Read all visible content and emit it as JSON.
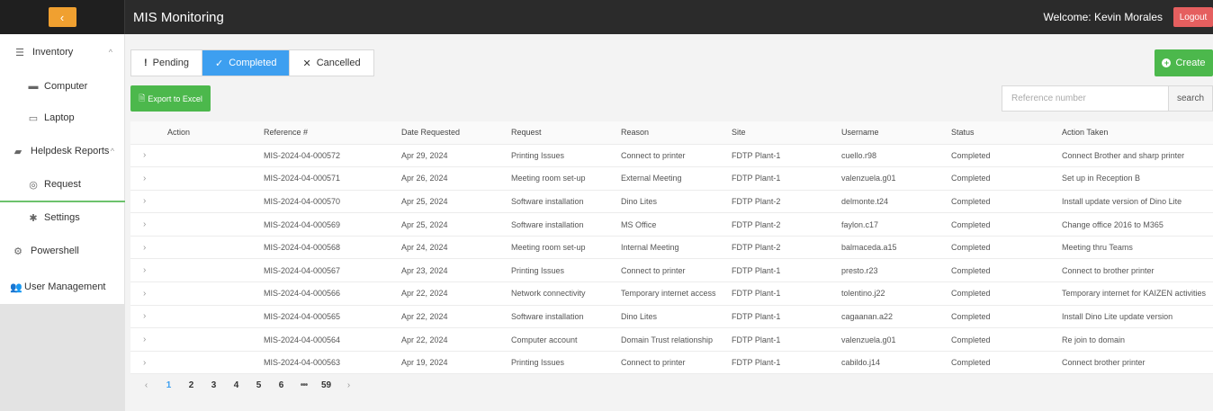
{
  "header": {
    "collapse_icon": "chevron-left-icon",
    "collapse_glyph": "‹",
    "title": "MIS Monitoring",
    "welcome": "Welcome: Kevin Morales",
    "logout_label": "Logout"
  },
  "sidebar": {
    "items": [
      {
        "label": "Inventory",
        "icon": "list-icon",
        "glyph": "☰",
        "chevron": "^"
      },
      {
        "label": "Computer",
        "icon": "desktop-icon",
        "glyph": "▬"
      },
      {
        "label": "Laptop",
        "icon": "laptop-icon",
        "glyph": "▭"
      },
      {
        "label": "Helpdesk Reports",
        "icon": "folder-icon",
        "glyph": "▰",
        "chevron": "^"
      },
      {
        "label": "Request",
        "icon": "headset-icon",
        "glyph": "◎"
      },
      {
        "label": "Settings",
        "icon": "gear-icon",
        "glyph": "✱"
      },
      {
        "label": "Powershell",
        "icon": "cog-icon",
        "glyph": "⚙"
      },
      {
        "label": "User Management",
        "icon": "users-icon",
        "glyph": "👥"
      }
    ]
  },
  "tabs": [
    {
      "label": "Pending",
      "glyph": "!"
    },
    {
      "label": "Completed",
      "glyph": "✓"
    },
    {
      "label": "Cancelled",
      "glyph": "✕"
    }
  ],
  "actions": {
    "create_label": "Create",
    "create_glyph": "+",
    "export_label": "Export to Excel",
    "export_glyph": "🗎"
  },
  "search": {
    "placeholder": "Reference number",
    "button_label": "search"
  },
  "table": {
    "columns": [
      "",
      "Action",
      "Reference #",
      "Date Requested",
      "Request",
      "Reason",
      "Site",
      "Username",
      "Status",
      "Action Taken"
    ],
    "expander_glyph": "›",
    "rows": [
      [
        "MIS-2024-04-000572",
        "Apr 29, 2024",
        "Printing Issues",
        "Connect to printer",
        "FDTP Plant-1",
        "cuello.r98",
        "Completed",
        "Connect Brother and sharp printer"
      ],
      [
        "MIS-2024-04-000571",
        "Apr 26, 2024",
        "Meeting room set-up",
        "External Meeting",
        "FDTP Plant-1",
        "valenzuela.g01",
        "Completed",
        "Set up in Reception B"
      ],
      [
        "MIS-2024-04-000570",
        "Apr 25, 2024",
        "Software installation",
        "Dino Lites",
        "FDTP Plant-2",
        "delmonte.t24",
        "Completed",
        "Install update version of Dino Lite"
      ],
      [
        "MIS-2024-04-000569",
        "Apr 25, 2024",
        "Software installation",
        "MS Office",
        "FDTP Plant-2",
        "faylon.c17",
        "Completed",
        "Change office 2016 to M365"
      ],
      [
        "MIS-2024-04-000568",
        "Apr 24, 2024",
        "Meeting room set-up",
        "Internal Meeting",
        "FDTP Plant-2",
        "balmaceda.a15",
        "Completed",
        "Meeting thru Teams"
      ],
      [
        "MIS-2024-04-000567",
        "Apr 23, 2024",
        "Printing Issues",
        "Connect to printer",
        "FDTP Plant-1",
        "presto.r23",
        "Completed",
        "Connect to brother printer"
      ],
      [
        "MIS-2024-04-000566",
        "Apr 22, 2024",
        "Network connectivity",
        "Temporary internet access",
        "FDTP Plant-1",
        "tolentino.j22",
        "Completed",
        "Temporary internet for KAIZEN activities"
      ],
      [
        "MIS-2024-04-000565",
        "Apr 22, 2024",
        "Software installation",
        "Dino Lites",
        "FDTP Plant-1",
        "cagaanan.a22",
        "Completed",
        "Install Dino Lite update version"
      ],
      [
        "MIS-2024-04-000564",
        "Apr 22, 2024",
        "Computer account",
        "Domain Trust relationship",
        "FDTP Plant-1",
        "valenzuela.g01",
        "Completed",
        "Re join to domain"
      ],
      [
        "MIS-2024-04-000563",
        "Apr 19, 2024",
        "Printing Issues",
        "Connect to printer",
        "FDTP Plant-1",
        "cabildo.j14",
        "Completed",
        "Connect brother printer"
      ]
    ]
  },
  "pagination": {
    "prev_glyph": "‹",
    "next_glyph": "›",
    "pages": [
      "1",
      "2",
      "3",
      "4",
      "5",
      "6",
      "•••",
      "59"
    ],
    "current": "1"
  },
  "colors": {
    "topbar": "#2b2b2b",
    "accent_blue": "#3d9ff0",
    "green": "#4cb84c",
    "logout_red": "#e55f5f",
    "collapse_orange": "#f0a030"
  }
}
